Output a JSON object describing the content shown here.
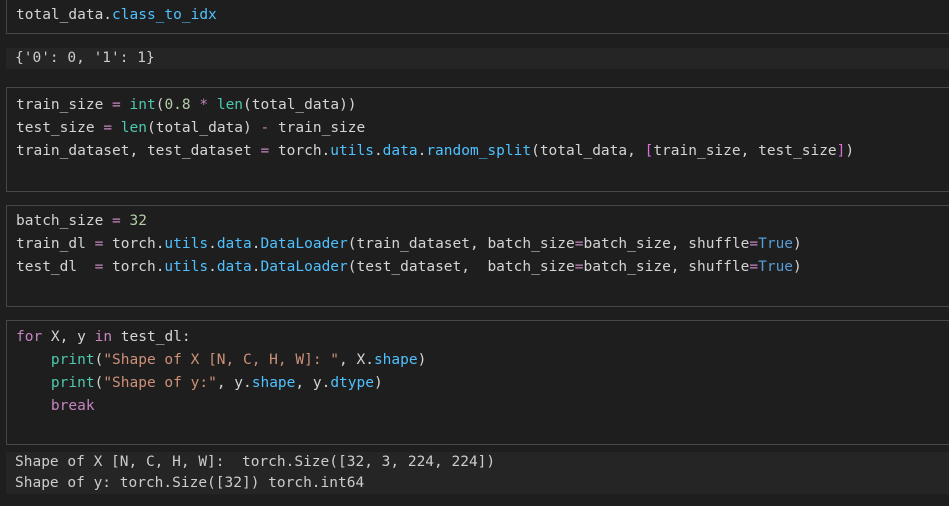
{
  "cells": [
    {
      "lines": [
        [
          {
            "t": "total_data.",
            "c": "plain"
          },
          {
            "t": "class_to_idx",
            "c": "attr"
          }
        ]
      ],
      "output": [
        "{'0': 0, '1': 1}"
      ]
    },
    {
      "lines": [
        [
          {
            "t": "train_size ",
            "c": "plain"
          },
          {
            "t": "=",
            "c": "op"
          },
          {
            "t": " ",
            "c": "plain"
          },
          {
            "t": "int",
            "c": "tealfn"
          },
          {
            "t": "(",
            "c": "plain"
          },
          {
            "t": "0.8",
            "c": "num"
          },
          {
            "t": " ",
            "c": "plain"
          },
          {
            "t": "*",
            "c": "op"
          },
          {
            "t": " ",
            "c": "plain"
          },
          {
            "t": "len",
            "c": "tealfn"
          },
          {
            "t": "(total_data))",
            "c": "plain"
          }
        ],
        [
          {
            "t": "test_size ",
            "c": "plain"
          },
          {
            "t": "=",
            "c": "op"
          },
          {
            "t": " ",
            "c": "plain"
          },
          {
            "t": "len",
            "c": "tealfn"
          },
          {
            "t": "(total_data) ",
            "c": "plain"
          },
          {
            "t": "-",
            "c": "op"
          },
          {
            "t": " train_size",
            "c": "plain"
          }
        ],
        [
          {
            "t": "train_dataset, test_dataset ",
            "c": "plain"
          },
          {
            "t": "=",
            "c": "op"
          },
          {
            "t": " torch.",
            "c": "plain"
          },
          {
            "t": "utils",
            "c": "attr"
          },
          {
            "t": ".",
            "c": "plain"
          },
          {
            "t": "data",
            "c": "attr"
          },
          {
            "t": ".",
            "c": "plain"
          },
          {
            "t": "random_split",
            "c": "attr"
          },
          {
            "t": "(total_data, ",
            "c": "plain"
          },
          {
            "t": "[",
            "c": "bracket"
          },
          {
            "t": "train_size, test_size",
            "c": "plain"
          },
          {
            "t": "]",
            "c": "bracket"
          },
          {
            "t": ")",
            "c": "plain"
          }
        ]
      ]
    },
    {
      "lines": [
        [
          {
            "t": "batch_size ",
            "c": "plain"
          },
          {
            "t": "=",
            "c": "op"
          },
          {
            "t": " ",
            "c": "plain"
          },
          {
            "t": "32",
            "c": "num"
          }
        ],
        [
          {
            "t": "train_dl ",
            "c": "plain"
          },
          {
            "t": "=",
            "c": "op"
          },
          {
            "t": " torch.",
            "c": "plain"
          },
          {
            "t": "utils",
            "c": "attr"
          },
          {
            "t": ".",
            "c": "plain"
          },
          {
            "t": "data",
            "c": "attr"
          },
          {
            "t": ".",
            "c": "plain"
          },
          {
            "t": "DataLoader",
            "c": "attr"
          },
          {
            "t": "(train_dataset, batch_size",
            "c": "plain"
          },
          {
            "t": "=",
            "c": "op"
          },
          {
            "t": "batch_size, shuffle",
            "c": "plain"
          },
          {
            "t": "=",
            "c": "op"
          },
          {
            "t": "True",
            "c": "blue"
          },
          {
            "t": ")",
            "c": "plain"
          }
        ],
        [
          {
            "t": "test_dl  ",
            "c": "plain"
          },
          {
            "t": "=",
            "c": "op"
          },
          {
            "t": " torch.",
            "c": "plain"
          },
          {
            "t": "utils",
            "c": "attr"
          },
          {
            "t": ".",
            "c": "plain"
          },
          {
            "t": "data",
            "c": "attr"
          },
          {
            "t": ".",
            "c": "plain"
          },
          {
            "t": "DataLoader",
            "c": "attr"
          },
          {
            "t": "(test_dataset,  batch_size",
            "c": "plain"
          },
          {
            "t": "=",
            "c": "op"
          },
          {
            "t": "batch_size, shuffle",
            "c": "plain"
          },
          {
            "t": "=",
            "c": "op"
          },
          {
            "t": "True",
            "c": "blue"
          },
          {
            "t": ")",
            "c": "plain"
          }
        ]
      ]
    },
    {
      "lines": [
        [
          {
            "t": "for",
            "c": "kw"
          },
          {
            "t": " X, y ",
            "c": "plain"
          },
          {
            "t": "in",
            "c": "kw"
          },
          {
            "t": " test_dl:",
            "c": "plain"
          }
        ],
        [
          {
            "t": "    ",
            "c": "plain"
          },
          {
            "t": "print",
            "c": "tealfn"
          },
          {
            "t": "(",
            "c": "plain"
          },
          {
            "t": "\"Shape of X [N, C, H, W]: \"",
            "c": "str"
          },
          {
            "t": ", X.",
            "c": "plain"
          },
          {
            "t": "shape",
            "c": "attr"
          },
          {
            "t": ")",
            "c": "plain"
          }
        ],
        [
          {
            "t": "    ",
            "c": "plain"
          },
          {
            "t": "print",
            "c": "tealfn"
          },
          {
            "t": "(",
            "c": "plain"
          },
          {
            "t": "\"Shape of y:\"",
            "c": "str"
          },
          {
            "t": ", y.",
            "c": "plain"
          },
          {
            "t": "shape",
            "c": "attr"
          },
          {
            "t": ", y.",
            "c": "plain"
          },
          {
            "t": "dtype",
            "c": "attr"
          },
          {
            "t": ")",
            "c": "plain"
          }
        ],
        [
          {
            "t": "    ",
            "c": "plain"
          },
          {
            "t": "break",
            "c": "kw"
          }
        ]
      ],
      "output": [
        "Shape of X [N, C, H, W]:  torch.Size([32, 3, 224, 224])",
        "Shape of y: torch.Size([32]) torch.int64"
      ]
    }
  ],
  "colors": {
    "background": "#1e1e1e",
    "cell_border": "#474747",
    "output_background": "#252526",
    "keyword": "#c586c0",
    "attribute": "#4fc1ff",
    "builtin": "#4ec9b0",
    "number": "#b5cea8",
    "string": "#ce9178",
    "constant": "#569cd6"
  }
}
